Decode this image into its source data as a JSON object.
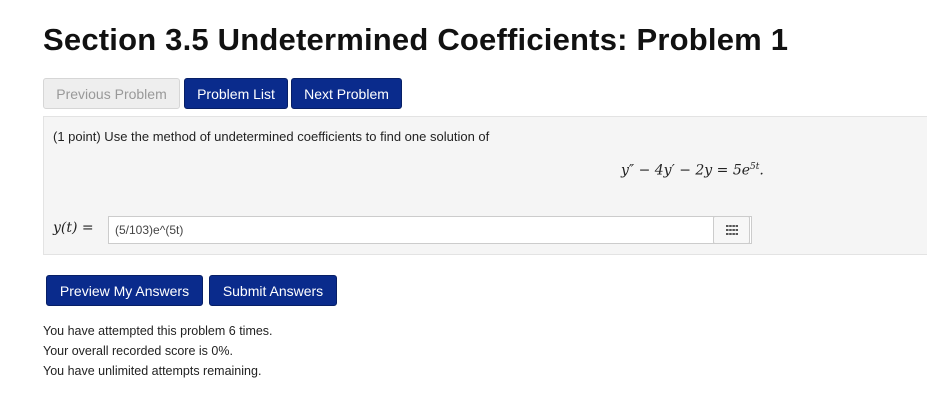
{
  "page": {
    "title": "Section 3.5 Undetermined Coefficients: Problem 1"
  },
  "nav": {
    "previous_label": "Previous Problem",
    "list_label": "Problem List",
    "next_label": "Next Problem"
  },
  "problem": {
    "intro": "(1 point) Use the method of undetermined coefficients to find one solution of",
    "equation_lhs": "y″ − 4y′ − 2y = 5e",
    "equation_exp": "5t",
    "equation_end": ".",
    "answer_label": "y(t) =",
    "answer_value": "(5/103)e^(5t)"
  },
  "actions": {
    "preview_label": "Preview My Answers",
    "submit_label": "Submit Answers"
  },
  "status": {
    "attempts": "You have attempted this problem 6 times.",
    "score": "Your overall recorded score is 0%.",
    "remaining": "You have unlimited attempts remaining."
  },
  "colors": {
    "primary_button": "#0a2b8c",
    "disabled_button": "#eeeeee",
    "problem_background": "#f5f5f5"
  },
  "icons": {
    "keypad": "keypad-grid-icon"
  }
}
